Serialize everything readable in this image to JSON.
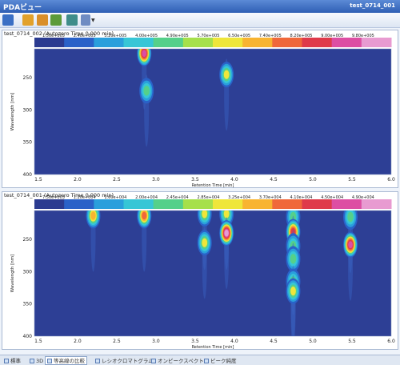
{
  "window": {
    "title": "PDAビュー",
    "right_title": "test_0714_001"
  },
  "toolbar": {
    "icons": [
      "report-icon",
      "folder-icon",
      "edit-icon",
      "chart-icon",
      "export-icon",
      "dropdown-chevron-icon"
    ]
  },
  "colorscale": [
    "#2b3b90",
    "#2a62c8",
    "#2a9fdc",
    "#37c6d6",
    "#55d08a",
    "#a6e04b",
    "#efe63a",
    "#f8b431",
    "#f0683a",
    "#df3a4a",
    "#dd4ea3",
    "#e89bd1"
  ],
  "panels": [
    {
      "id": "top",
      "title": "test_0714_002 (Autozero Time 0.000 min)",
      "scale_labels": [
        "1.50e+005",
        "2.40e+005",
        "3.20e+005",
        "4.00e+005",
        "4.90e+005",
        "5.70e+005",
        "6.50e+005",
        "7.40e+005",
        "8.20e+005",
        "9.00e+005",
        "9.80e+005"
      ],
      "ylabel": "Wavelength [nm]",
      "xlabel": "Retention Time [min]",
      "yticks": [
        "250",
        "300",
        "350",
        "400"
      ],
      "xticks": [
        "1.5",
        "2.0",
        "2.5",
        "3.0",
        "3.5",
        "4.0",
        "4.5",
        "5.0",
        "5.5",
        "6.0"
      ]
    },
    {
      "id": "bottom",
      "title": "test_0714_001 (Autozero Time 0.000 min)",
      "scale_labels": [
        "7.50e+003",
        "1.20e+004",
        "1.60e+004",
        "2.00e+004",
        "2.45e+004",
        "2.85e+004",
        "3.25e+004",
        "3.70e+004",
        "4.10e+004",
        "4.50e+004",
        "4.90e+004"
      ],
      "ylabel": "Wavelength [nm]",
      "xlabel": "Retention Time [min]",
      "yticks": [
        "250",
        "300",
        "350",
        "400"
      ],
      "xticks": [
        "1.5",
        "2.0",
        "2.5",
        "3.0",
        "3.5",
        "4.0",
        "4.5",
        "5.0",
        "5.5",
        "6.0"
      ]
    }
  ],
  "tabs": [
    {
      "label": "標準",
      "active": false
    },
    {
      "label": "3D",
      "active": false
    },
    {
      "label": "等高線の比較",
      "active": true
    },
    {
      "label": "レシオクロマトグラム",
      "active": false
    },
    {
      "label": "オンピークスペクトル",
      "active": false
    },
    {
      "label": "ピーク純度",
      "active": false
    }
  ],
  "chart_data": [
    {
      "type": "heatmap",
      "title": "test_0714_002 (Autozero Time 0.000 min)",
      "xlabel": "Retention Time [min]",
      "ylabel": "Wavelength [nm]",
      "xlim": [
        1.45,
        6.0
      ],
      "ylim": [
        400,
        205
      ],
      "peaks": [
        {
          "x": 2.85,
          "y": 212,
          "intensity": 0.92
        },
        {
          "x": 2.88,
          "y": 270,
          "intensity": 0.4
        },
        {
          "x": 3.9,
          "y": 245,
          "intensity": 0.45
        }
      ]
    },
    {
      "type": "heatmap",
      "title": "test_0714_001 (Autozero Time 0.000 min)",
      "xlabel": "Retention Time [min]",
      "ylabel": "Wavelength [nm]",
      "xlim": [
        1.45,
        6.0
      ],
      "ylim": [
        400,
        205
      ],
      "peaks": [
        {
          "x": 2.2,
          "y": 213,
          "intensity": 0.55
        },
        {
          "x": 2.85,
          "y": 213,
          "intensity": 0.7
        },
        {
          "x": 3.62,
          "y": 210,
          "intensity": 0.45
        },
        {
          "x": 3.62,
          "y": 255,
          "intensity": 0.45
        },
        {
          "x": 3.9,
          "y": 210,
          "intensity": 0.45
        },
        {
          "x": 3.9,
          "y": 240,
          "intensity": 0.95
        },
        {
          "x": 4.75,
          "y": 215,
          "intensity": 0.35
        },
        {
          "x": 4.75,
          "y": 238,
          "intensity": 0.8
        },
        {
          "x": 4.75,
          "y": 260,
          "intensity": 0.4
        },
        {
          "x": 4.75,
          "y": 280,
          "intensity": 0.35
        },
        {
          "x": 4.75,
          "y": 315,
          "intensity": 0.35
        },
        {
          "x": 4.75,
          "y": 330,
          "intensity": 0.5
        },
        {
          "x": 5.48,
          "y": 215,
          "intensity": 0.4
        },
        {
          "x": 5.48,
          "y": 258,
          "intensity": 0.85
        }
      ]
    }
  ]
}
